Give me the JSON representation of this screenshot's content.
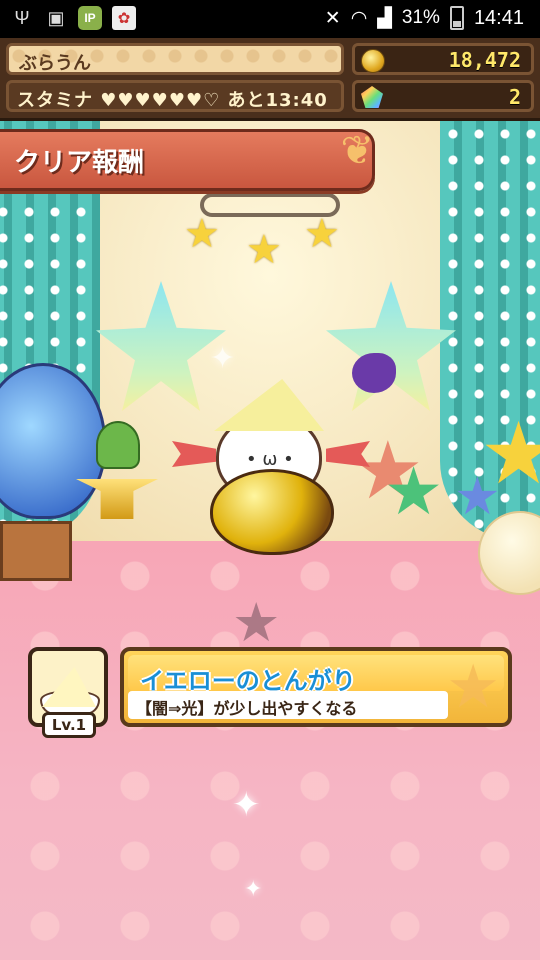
{
  "status_bar": {
    "icons": [
      "usb-icon",
      "image-icon",
      "ip-app-icon",
      "bow-app-icon"
    ],
    "ip_label": "IP",
    "battery": "31%",
    "time": "14:41"
  },
  "header": {
    "player_name": "ぶらうん",
    "stamina_label": "スタミナ ♥♥♥♥♥♥♡ あと13:40",
    "coins": "18,472",
    "gems": "2"
  },
  "banner": {
    "title": "クリア報酬"
  },
  "reward": {
    "level": "Lv.1",
    "item_name": "イエローのとんがり",
    "description": "【闇⇒光】が少し出やすくなる"
  },
  "colors": {
    "banner": "#d86a4f",
    "card": "#f7c24a",
    "title_text": "#1a8fd6",
    "curtain": "#56c7bd",
    "floor": "#f6b5c4"
  }
}
